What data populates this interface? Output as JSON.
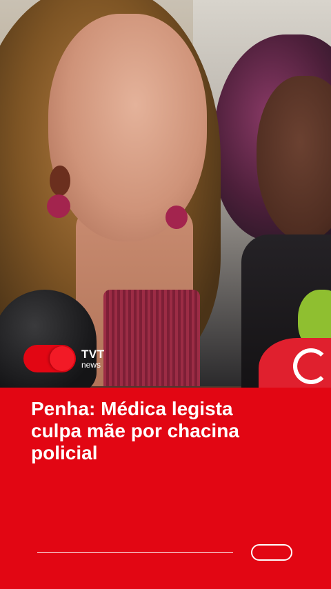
{
  "logo": {
    "brand": "TVT",
    "sub": "news"
  },
  "headline": "Penha: Médica legista\nculpa mãe por chacina\npolicial",
  "colors": {
    "accent": "#e20613",
    "text": "#ffffff"
  }
}
